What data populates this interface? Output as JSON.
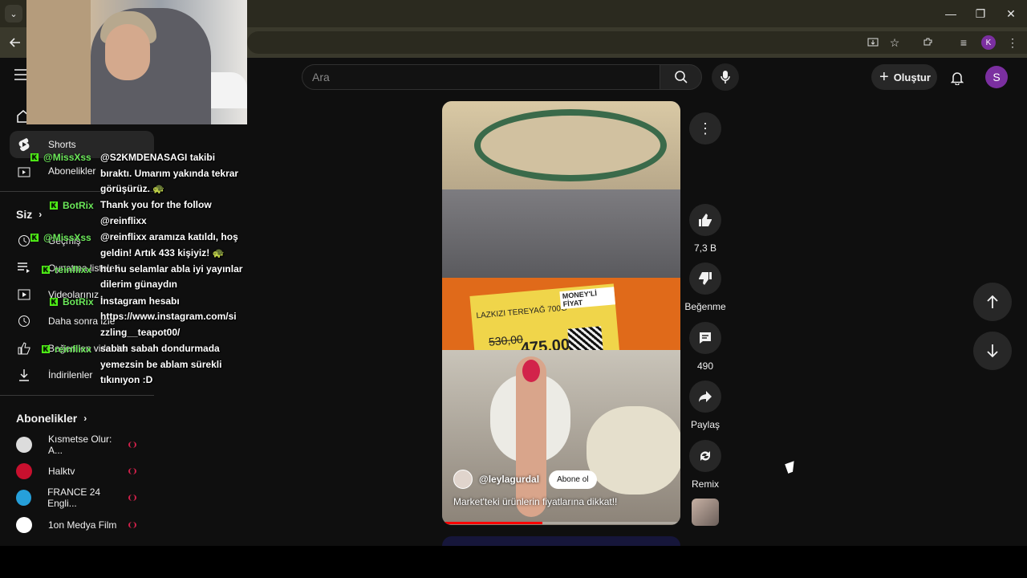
{
  "browser": {
    "window_controls": {
      "minimize": "—",
      "maximize": "❐",
      "close": "✕"
    },
    "profile_initial": "K"
  },
  "header": {
    "search_placeholder": "Ara",
    "create_label": "Oluştur",
    "avatar_initial": "S"
  },
  "sidebar": {
    "items": [
      {
        "label": "Shorts"
      },
      {
        "label": "Abonelikler"
      },
      {
        "label": "Geçmiş"
      },
      {
        "label": "Oynatma listeleri"
      },
      {
        "label": "Videolarınız"
      },
      {
        "label": "Daha sonra izle"
      },
      {
        "label": "Beğenilen videolar"
      },
      {
        "label": "İndirilenler"
      }
    ],
    "you_heading": "Siz",
    "subscriptions_heading": "Abonelikler",
    "subscriptions": [
      {
        "name": "Kısmetse Olur: A...",
        "color": "#dcdcdc"
      },
      {
        "name": "Halktv",
        "color": "#c8102e"
      },
      {
        "name": "FRANCE 24 Engli...",
        "color": "#26a0da"
      },
      {
        "name": "1on Medya Film",
        "color": "#ffffff"
      }
    ]
  },
  "chat": [
    {
      "user": "@MissXss",
      "lines": [
        "@S2KMDENASAGI takibi",
        "bıraktı. Umarım yakında tekrar",
        "görüşürüz. 🐢"
      ]
    },
    {
      "user": "BotRix",
      "lines": [
        "Thank you for the follow",
        "@reinflixx"
      ]
    },
    {
      "user": "@MissXss",
      "lines": [
        "@reinflixx aramıza katıldı, hoş",
        "geldin! Artık 433 kişiyiz! 🐢"
      ]
    },
    {
      "user": "reinflixx",
      "lines": [
        "hu hu selamlar abla iyi yayınlar",
        "dilerim günaydın"
      ]
    },
    {
      "user": "BotRix",
      "lines": [
        "İnstagram hesabı",
        "https://www.instagram.com/si",
        "zzling__teapot00/"
      ]
    },
    {
      "user": "reinflixx",
      "lines": [
        "sabah sabah dondurmada",
        "yemezsin be ablam sürekli",
        "tıkınıyon :D"
      ]
    }
  ],
  "short": {
    "channel": "@leylagurdal",
    "subscribe_label": "Abone ol",
    "caption": "Market'teki ürünlerin fiyatlarına dikkat!!",
    "tag_product": "LAZKIZI TEREYAĞ 700G",
    "tag_brand": "MONEY'Lİ FİYAT",
    "old_price": "530,00",
    "new_price": "475,00",
    "progress": 0.42
  },
  "actions": {
    "likes": "7,3 B",
    "dislike_label": "Beğenme",
    "comments": "490",
    "share_label": "Paylaş",
    "remix_label": "Remix"
  }
}
